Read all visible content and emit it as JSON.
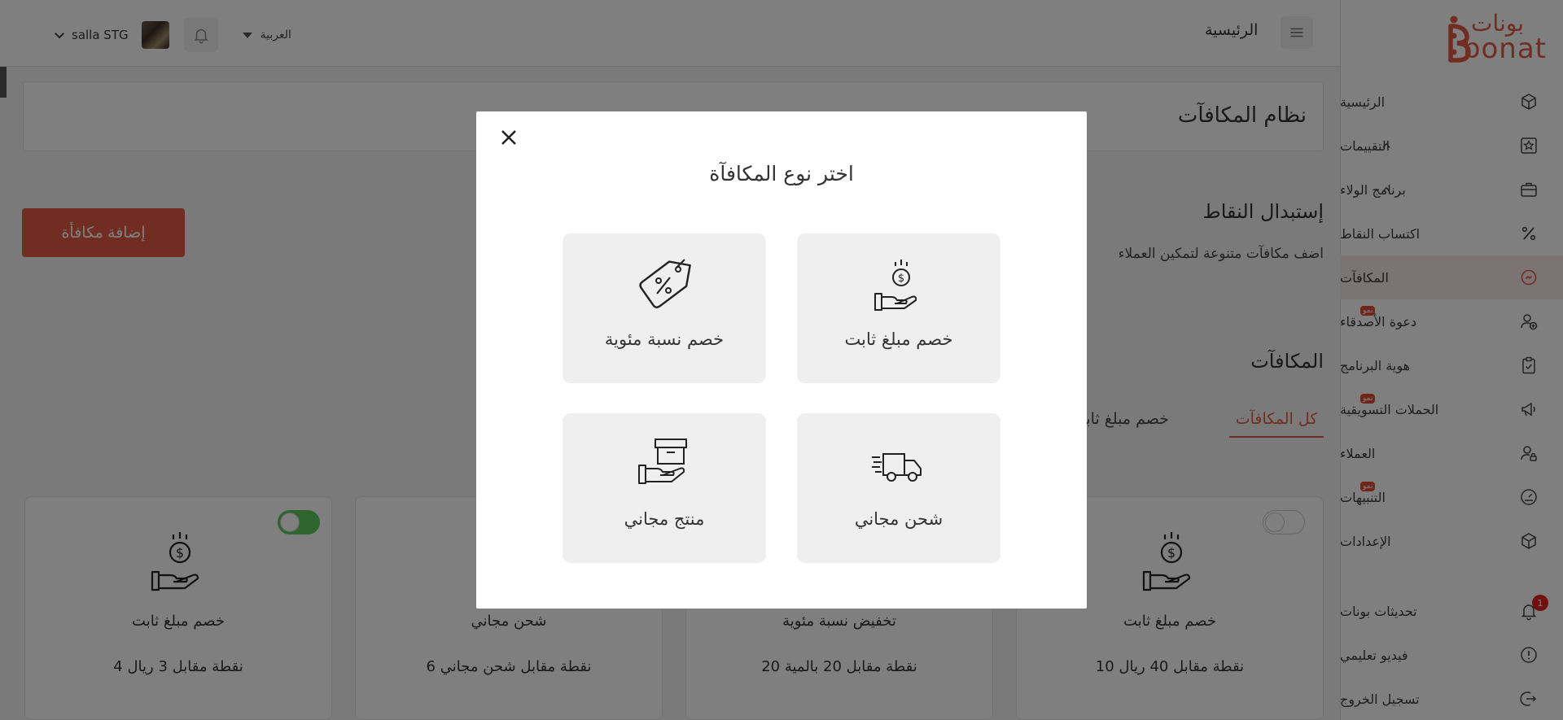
{
  "sidebar": {
    "logo_ar": "بونات",
    "logo_en": "bonat",
    "items": [
      {
        "label": "الرئيسية",
        "icon": "cube-icon"
      },
      {
        "label": "التقييمات",
        "icon": "star-icon"
      },
      {
        "label": "برنامج الولاء",
        "icon": "briefcase-icon"
      },
      {
        "label": "اكتساب النقاط",
        "icon": "percent-icon"
      },
      {
        "label": "المكافآت",
        "icon": "reward-icon"
      },
      {
        "label": "دعوة الأصدقاء",
        "icon": "user-add-icon",
        "badge": "نمو"
      },
      {
        "label": "هوية البرنامج",
        "icon": "clipboard-icon"
      },
      {
        "label": "الحملات التسويقية",
        "icon": "megaphone-icon",
        "badge": "نمو"
      },
      {
        "label": "العملاء",
        "icon": "user-lock-icon"
      },
      {
        "label": "التنبيهات",
        "icon": "gauge-icon",
        "badge": "نمو"
      },
      {
        "label": "الإعدادات",
        "icon": "cube-icon"
      }
    ],
    "bottom": [
      {
        "label": "تحديثات بونات",
        "icon": "bell-icon",
        "badge": "1"
      },
      {
        "label": "فيديو تعليمي",
        "icon": "info-icon"
      },
      {
        "label": "تسجيل الخروج",
        "icon": "logout-icon"
      }
    ]
  },
  "topbar": {
    "page": "الرئيسية",
    "user_name": "salla STG",
    "language": "العربية"
  },
  "main": {
    "card_title": "نظام المكافآت",
    "add_button": "إضافة مكافأة",
    "section_title": "إستبدال النقاط",
    "section_desc": "اضف مكافآت متنوعة لتمكين العملاء",
    "rewards_title": "المكافآت",
    "tabs": [
      "كل المكافآت",
      "خصم مبلغ ثابت"
    ],
    "reward_cards": [
      {
        "name": "خصم مبلغ ثابت",
        "points": "10 نقطة مقابل 40 ريال",
        "enabled": false
      },
      {
        "name": "تخفيض نسبة مئوية",
        "points": "20 نقطة مقابل 20 بالمية",
        "enabled": null
      },
      {
        "name": "شحن مجاني",
        "points": "6 نقطة مقابل شحن مجاني",
        "enabled": null
      },
      {
        "name": "خصم مبلغ ثابت",
        "points": "4 نقطة مقابل 3 ريال",
        "enabled": true
      }
    ]
  },
  "modal": {
    "title": "اختر نوع المكافآة",
    "options": [
      {
        "label": "خصم مبلغ ثابت",
        "icon": "money-hand-icon"
      },
      {
        "label": "خصم نسبة مئوية",
        "icon": "percent-tag-icon"
      },
      {
        "label": "شحن مجاني",
        "icon": "delivery-truck-icon"
      },
      {
        "label": "منتج مجاني",
        "icon": "box-hand-icon"
      }
    ]
  },
  "colors": {
    "accent": "#e35b45",
    "toggle_on": "#5cc95c",
    "active_nav_bg": "#f7e9e6"
  }
}
